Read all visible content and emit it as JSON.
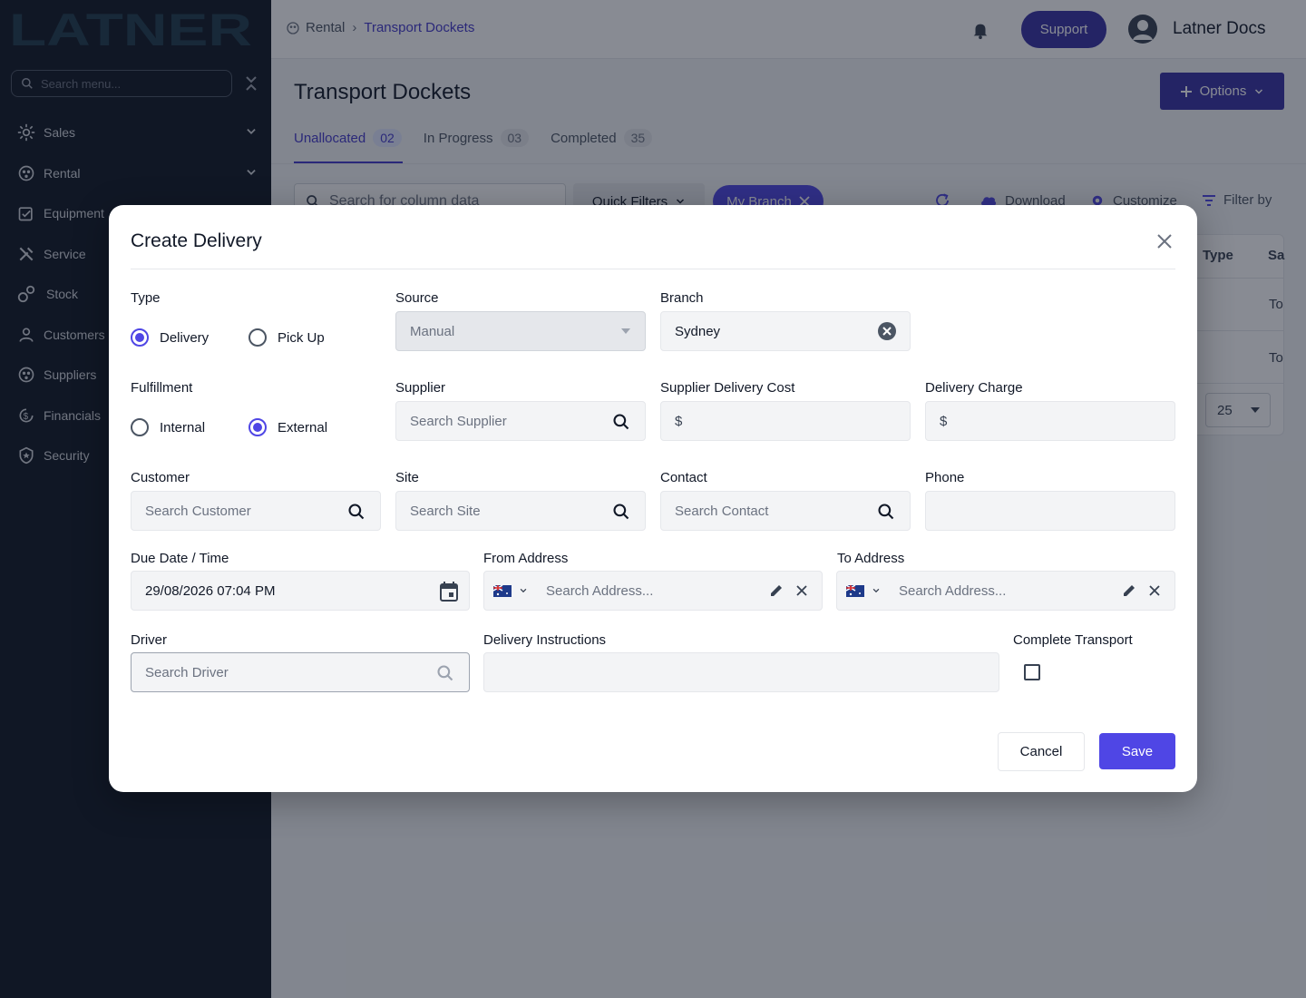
{
  "app": {
    "logo_text": "LATNER",
    "sidebar_search_placeholder": "Search menu...",
    "nav": [
      {
        "label": "Sales",
        "icon": "sales-icon",
        "expandable": true
      },
      {
        "label": "Rental",
        "icon": "rental-icon",
        "expandable": true
      },
      {
        "label": "Equipment",
        "icon": "equipment-icon",
        "expandable": false
      },
      {
        "label": "Service",
        "icon": "service-icon",
        "expandable": false
      },
      {
        "label": "Stock",
        "icon": "stock-icon",
        "expandable": false
      },
      {
        "label": "Customers",
        "icon": "customers-icon",
        "expandable": false
      },
      {
        "label": "Suppliers",
        "icon": "suppliers-icon",
        "expandable": false
      },
      {
        "label": "Financials",
        "icon": "financials-icon",
        "expandable": false
      },
      {
        "label": "Security",
        "icon": "security-icon",
        "expandable": false
      }
    ]
  },
  "header": {
    "breadcrumb_root": "Rental",
    "breadcrumb_current": "Transport Dockets",
    "support_label": "Support",
    "user_name": "Latner Docs"
  },
  "page": {
    "title": "Transport Dockets",
    "options_label": "Options",
    "tabs": [
      {
        "label": "Unallocated",
        "count": "02",
        "active": true
      },
      {
        "label": "In Progress",
        "count": "03",
        "active": false
      },
      {
        "label": "Completed",
        "count": "35",
        "active": false
      }
    ],
    "table_search_placeholder": "Search for column data",
    "quick_filters_label": "Quick Filters",
    "branch_chip_label": "My Branch",
    "tools": {
      "download": "Download",
      "customize": "Customize",
      "filter_by": "Filter by"
    },
    "columns": [
      "Type",
      "Sa"
    ],
    "rows": [
      [
        "To"
      ],
      [
        "To"
      ]
    ],
    "page_size": "25"
  },
  "modal": {
    "title": "Create Delivery",
    "type": {
      "label": "Type",
      "options": [
        "Delivery",
        "Pick Up"
      ],
      "selected": "Delivery"
    },
    "fulfillment": {
      "label": "Fulfillment",
      "options": [
        "Internal",
        "External"
      ],
      "selected": "External"
    },
    "source": {
      "label": "Source",
      "value": "Manual"
    },
    "branch": {
      "label": "Branch",
      "value": "Sydney"
    },
    "supplier": {
      "label": "Supplier",
      "placeholder": "Search Supplier"
    },
    "supplier_delivery_cost": {
      "label": "Supplier Delivery Cost",
      "prefix": "$"
    },
    "delivery_charge": {
      "label": "Delivery Charge",
      "prefix": "$"
    },
    "customer": {
      "label": "Customer",
      "placeholder": "Search Customer"
    },
    "site": {
      "label": "Site",
      "placeholder": "Search Site"
    },
    "contact": {
      "label": "Contact",
      "placeholder": "Search Contact"
    },
    "phone": {
      "label": "Phone",
      "value": ""
    },
    "due_date": {
      "label": "Due Date / Time",
      "value": "29/08/2026 07:04 PM"
    },
    "from_address": {
      "label": "From Address",
      "placeholder": "Search Address..."
    },
    "to_address": {
      "label": "To Address",
      "placeholder": "Search Address..."
    },
    "driver": {
      "label": "Driver",
      "placeholder": "Search Driver"
    },
    "delivery_instructions": {
      "label": "Delivery Instructions",
      "value": ""
    },
    "complete_transport": {
      "label": "Complete Transport",
      "checked": false
    },
    "cancel_label": "Cancel",
    "save_label": "Save"
  },
  "colors": {
    "primary": "#4f46e5",
    "primary_dark": "#3730a3",
    "sidebar_bg": "#0f1623"
  }
}
